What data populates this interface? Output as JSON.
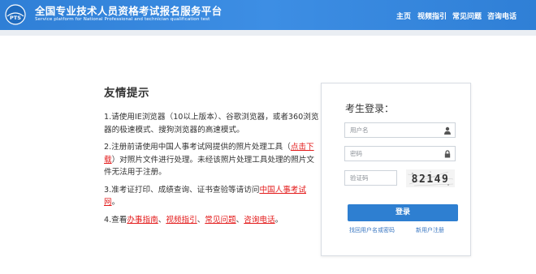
{
  "header": {
    "title": "全国专业技术人员资格考试报名服务平台",
    "subtitle": "Service platform for National Professional and technician qualification test",
    "logo_text": "PTS",
    "nav": [
      "主页",
      "视频指引",
      "常见问题",
      "咨询电话"
    ],
    "bg_color": "#3a8be0"
  },
  "notice": {
    "title": "友情提示",
    "tips": [
      {
        "text": "1.请使用IE浏览器（10以上版本）、谷歌浏览器，或者360浏览器的极速模式、搜狗浏览器的高速模式。"
      },
      {
        "pre": "2.注册前请使用中国人事考试网提供的照片处理工具（",
        "link": "点击下载",
        "post": "）对照片文件进行处理。未经该照片处理工具处理的照片文件无法用于注册。"
      },
      {
        "pre": "3.准考证打印、成绩查询、证书查验等请访问",
        "link": "中国人事考试网",
        "post": "。"
      },
      {
        "pre": "4.查看",
        "links": [
          "办事指南",
          "视频指引",
          "常见问题",
          "咨询电话"
        ],
        "sep": "、",
        "post": "。"
      }
    ]
  },
  "login": {
    "title": "考生登录：",
    "username_placeholder": "用户名",
    "password_placeholder": "密码",
    "captcha_placeholder": "验证码",
    "captcha_text": "82149",
    "submit_label": "登录",
    "forgot_label": "找回用户名或密码",
    "register_label": "新用户注册",
    "button_color": "#2e7fd1"
  }
}
